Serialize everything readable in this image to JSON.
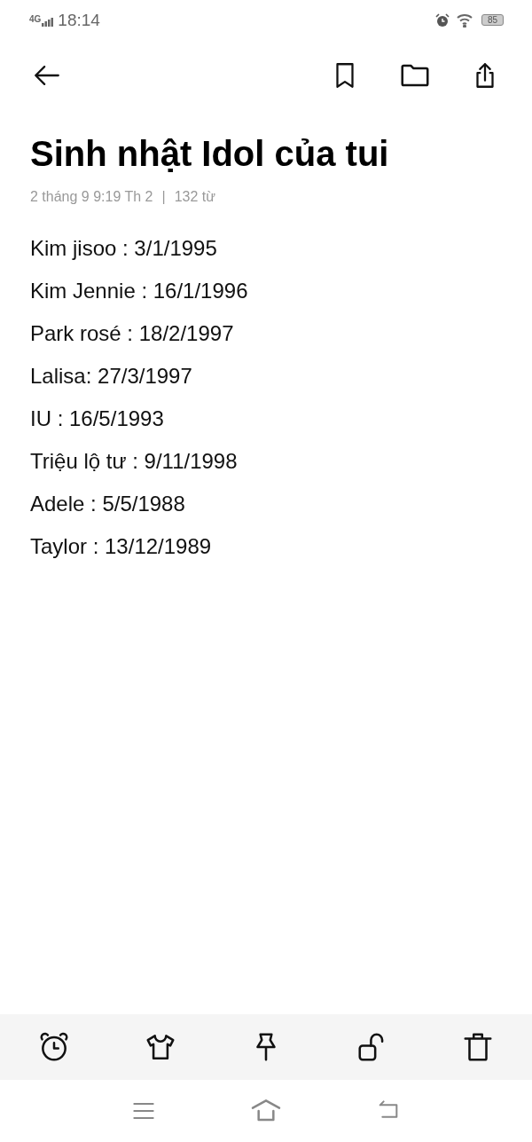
{
  "status_bar": {
    "network": "4G",
    "time": "18:14",
    "battery": "85"
  },
  "title": "Sinh nhật Idol của tui",
  "meta": {
    "date": "2 tháng 9 9:19 Th 2",
    "separator": "|",
    "word_count": "132 từ"
  },
  "lines": [
    "Kim jisoo : 3/1/1995",
    "Kim Jennie : 16/1/1996",
    "Park rosé : 18/2/1997",
    "Lalisa: 27/3/1997",
    "IU : 16/5/1993",
    "Triệu lộ tư : 9/11/1998",
    "Adele : 5/5/1988",
    "Taylor : 13/12/1989"
  ]
}
